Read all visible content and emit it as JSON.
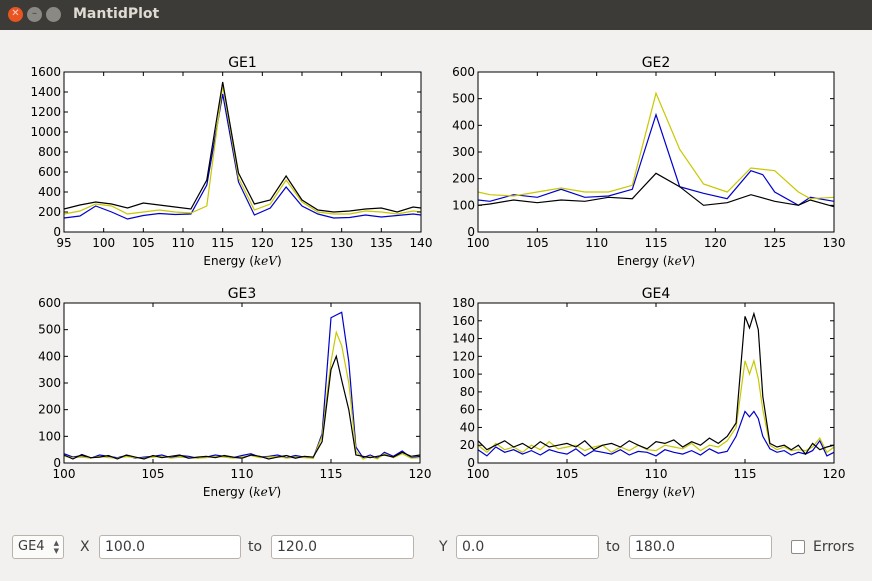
{
  "window": {
    "title": "MantidPlot"
  },
  "controls": {
    "selector_value": "GE4",
    "x_label": "X",
    "x_from": "100.0",
    "x_to_label": "to",
    "x_to": "120.0",
    "y_label": "Y",
    "y_from": "0.0",
    "y_to_label": "to",
    "y_to": "180.0",
    "errors_label": "Errors",
    "errors_checked": false
  },
  "series_colors": [
    "#0000cc",
    "#c8c800",
    "#000000"
  ],
  "chart_data": [
    {
      "type": "line",
      "title": "GE1",
      "xlabel": "Energy ",
      "xunit": "keV",
      "xlim": [
        95,
        140
      ],
      "ylim": [
        0,
        1600
      ],
      "xticks": [
        95,
        100,
        105,
        110,
        115,
        120,
        125,
        130,
        135,
        140
      ],
      "yticks": [
        0,
        200,
        400,
        600,
        800,
        1000,
        1200,
        1400,
        1600
      ],
      "series": [
        {
          "x": [
            95,
            97,
            99,
            101,
            103,
            105,
            107,
            109,
            111,
            113,
            115,
            117,
            119,
            121,
            123,
            125,
            127,
            129,
            131,
            133,
            135,
            137,
            139,
            140
          ],
          "values": [
            140,
            160,
            260,
            200,
            130,
            165,
            185,
            175,
            180,
            470,
            1380,
            500,
            170,
            240,
            450,
            260,
            180,
            140,
            145,
            170,
            150,
            165,
            180,
            170
          ]
        },
        {
          "x": [
            95,
            97,
            99,
            101,
            103,
            105,
            107,
            109,
            111,
            113,
            115,
            117,
            119,
            121,
            123,
            125,
            127,
            129,
            131,
            133,
            135,
            137,
            139,
            140
          ],
          "values": [
            180,
            210,
            280,
            260,
            180,
            200,
            220,
            200,
            190,
            260,
            1470,
            540,
            220,
            280,
            520,
            300,
            200,
            180,
            180,
            210,
            200,
            180,
            210,
            200
          ]
        },
        {
          "x": [
            95,
            97,
            99,
            101,
            103,
            105,
            107,
            109,
            111,
            113,
            115,
            117,
            119,
            121,
            123,
            125,
            127,
            129,
            131,
            133,
            135,
            137,
            139,
            140
          ],
          "values": [
            230,
            270,
            300,
            280,
            240,
            290,
            270,
            250,
            230,
            520,
            1500,
            590,
            280,
            320,
            560,
            320,
            220,
            200,
            210,
            230,
            240,
            200,
            250,
            240
          ]
        }
      ]
    },
    {
      "type": "line",
      "title": "GE2",
      "xlabel": "Energy ",
      "xunit": "keV",
      "xlim": [
        100,
        130
      ],
      "ylim": [
        0,
        600
      ],
      "xticks": [
        100,
        105,
        110,
        115,
        120,
        125,
        130
      ],
      "yticks": [
        0,
        100,
        200,
        300,
        400,
        500,
        600
      ],
      "series": [
        {
          "x": [
            100,
            101,
            103,
            105,
            107,
            109,
            111,
            113,
            115,
            117,
            119,
            121,
            123,
            124,
            125,
            127,
            128,
            130
          ],
          "values": [
            120,
            115,
            140,
            130,
            160,
            130,
            135,
            160,
            440,
            170,
            145,
            125,
            230,
            215,
            150,
            100,
            130,
            115
          ]
        },
        {
          "x": [
            100,
            101,
            103,
            105,
            107,
            109,
            111,
            113,
            115,
            117,
            119,
            121,
            123,
            125,
            127,
            128,
            130
          ],
          "values": [
            150,
            140,
            135,
            150,
            165,
            150,
            150,
            175,
            520,
            310,
            180,
            150,
            240,
            230,
            150,
            125,
            130
          ]
        },
        {
          "x": [
            100,
            101,
            103,
            105,
            107,
            109,
            111,
            113,
            115,
            117,
            119,
            121,
            123,
            125,
            127,
            128,
            130
          ],
          "values": [
            100,
            105,
            120,
            110,
            120,
            115,
            130,
            125,
            220,
            170,
            100,
            110,
            140,
            115,
            100,
            120,
            95
          ]
        }
      ]
    },
    {
      "type": "line",
      "title": "GE3",
      "xlabel": "Energy ",
      "xunit": "keV",
      "xlim": [
        100,
        120
      ],
      "ylim": [
        0,
        600
      ],
      "xticks": [
        100,
        105,
        110,
        115,
        120
      ],
      "yticks": [
        0,
        100,
        200,
        300,
        400,
        500,
        600
      ],
      "series": [
        {
          "x": [
            100,
            100.5,
            101,
            101.5,
            102,
            102.5,
            103,
            103.5,
            104,
            104.5,
            105,
            105.5,
            106,
            106.5,
            107,
            107.5,
            108,
            108.5,
            109,
            109.5,
            110,
            110.5,
            111,
            111.5,
            112,
            112.5,
            113,
            113.5,
            114,
            114.5,
            115,
            115.3,
            115.6,
            116,
            116.4,
            116.8,
            117.2,
            117.6,
            118,
            118.5,
            119,
            119.5,
            120
          ],
          "values": [
            35,
            22,
            28,
            18,
            30,
            25,
            20,
            28,
            18,
            22,
            25,
            30,
            20,
            28,
            25,
            18,
            22,
            30,
            25,
            20,
            28,
            35,
            22,
            25,
            30,
            20,
            28,
            22,
            18,
            110,
            545,
            555,
            565,
            380,
            60,
            20,
            30,
            18,
            40,
            25,
            45,
            20,
            25
          ]
        },
        {
          "x": [
            100,
            100.5,
            101,
            101.5,
            102,
            102.5,
            103,
            103.5,
            104,
            104.5,
            105,
            105.5,
            106,
            106.5,
            107,
            107.5,
            108,
            108.5,
            109,
            109.5,
            110,
            110.5,
            111,
            111.5,
            112,
            112.5,
            113,
            113.5,
            114,
            114.5,
            115,
            115.3,
            115.6,
            116,
            116.4,
            116.8,
            117.2,
            117.6,
            118,
            118.5,
            119,
            119.5,
            120
          ],
          "values": [
            25,
            20,
            22,
            18,
            25,
            20,
            18,
            24,
            20,
            18,
            22,
            25,
            18,
            22,
            20,
            18,
            20,
            25,
            22,
            18,
            22,
            28,
            20,
            22,
            25,
            18,
            22,
            20,
            18,
            100,
            380,
            490,
            440,
            300,
            45,
            15,
            25,
            15,
            35,
            20,
            35,
            18,
            20
          ]
        },
        {
          "x": [
            100,
            100.5,
            101,
            101.5,
            102,
            102.5,
            103,
            103.5,
            104,
            104.5,
            105,
            105.5,
            106,
            106.5,
            107,
            107.5,
            108,
            108.5,
            109,
            109.5,
            110,
            110.5,
            111,
            111.5,
            112,
            112.5,
            113,
            113.5,
            114,
            114.5,
            115,
            115.3,
            115.6,
            116,
            116.4,
            116.8,
            117.2,
            117.6,
            118,
            118.5,
            119,
            119.5,
            120
          ],
          "values": [
            30,
            15,
            32,
            20,
            22,
            28,
            15,
            30,
            22,
            15,
            28,
            20,
            25,
            30,
            18,
            22,
            25,
            20,
            28,
            22,
            18,
            30,
            25,
            15,
            22,
            28,
            18,
            25,
            22,
            80,
            350,
            400,
            310,
            200,
            30,
            25,
            20,
            25,
            30,
            22,
            40,
            25,
            30
          ]
        }
      ]
    },
    {
      "type": "line",
      "title": "GE4",
      "xlabel": "Energy ",
      "xunit": "keV",
      "xlim": [
        100,
        120
      ],
      "ylim": [
        0,
        180
      ],
      "xticks": [
        100,
        105,
        110,
        115,
        120
      ],
      "yticks": [
        0,
        20,
        40,
        60,
        80,
        100,
        120,
        140,
        160,
        180
      ],
      "series": [
        {
          "x": [
            100,
            100.5,
            101,
            101.5,
            102,
            102.5,
            103,
            103.5,
            104,
            104.5,
            105,
            105.5,
            106,
            106.5,
            107,
            107.5,
            108,
            108.5,
            109,
            109.5,
            110,
            110.5,
            111,
            111.5,
            112,
            112.5,
            113,
            113.5,
            114,
            114.5,
            115,
            115.25,
            115.5,
            115.75,
            116,
            116.4,
            116.8,
            117.2,
            117.6,
            118,
            118.4,
            118.8,
            119.2,
            119.6,
            120
          ],
          "values": [
            15,
            8,
            18,
            12,
            15,
            10,
            14,
            9,
            15,
            12,
            10,
            16,
            8,
            14,
            12,
            10,
            15,
            9,
            13,
            12,
            8,
            15,
            12,
            10,
            14,
            9,
            16,
            11,
            13,
            30,
            58,
            52,
            58,
            50,
            30,
            16,
            12,
            14,
            9,
            12,
            10,
            14,
            25,
            8,
            12
          ]
        },
        {
          "x": [
            100,
            100.5,
            101,
            101.5,
            102,
            102.5,
            103,
            103.5,
            104,
            104.5,
            105,
            105.5,
            106,
            106.5,
            107,
            107.5,
            108,
            108.5,
            109,
            109.5,
            110,
            110.5,
            111,
            111.5,
            112,
            112.5,
            113,
            113.5,
            114,
            114.5,
            115,
            115.25,
            115.5,
            115.75,
            116,
            116.4,
            116.8,
            117.2,
            117.6,
            118,
            118.4,
            118.8,
            119.2,
            119.6,
            120
          ],
          "values": [
            20,
            12,
            22,
            15,
            18,
            12,
            20,
            15,
            24,
            16,
            18,
            20,
            14,
            18,
            20,
            12,
            18,
            14,
            20,
            15,
            14,
            20,
            18,
            16,
            22,
            14,
            20,
            18,
            25,
            40,
            115,
            100,
            115,
            95,
            60,
            20,
            15,
            18,
            14,
            15,
            14,
            18,
            28,
            12,
            18
          ]
        },
        {
          "x": [
            100,
            100.5,
            101,
            101.5,
            102,
            102.5,
            103,
            103.5,
            104,
            104.5,
            105,
            105.5,
            106,
            106.5,
            107,
            107.5,
            108,
            108.5,
            109,
            109.5,
            110,
            110.5,
            111,
            111.5,
            112,
            112.5,
            113,
            113.5,
            114,
            114.5,
            115,
            115.25,
            115.5,
            115.75,
            116,
            116.4,
            116.8,
            117.2,
            117.6,
            118,
            118.4,
            118.8,
            119.2,
            119.6,
            120
          ],
          "values": [
            25,
            15,
            20,
            25,
            18,
            22,
            16,
            24,
            18,
            20,
            22,
            18,
            25,
            15,
            20,
            22,
            18,
            25,
            20,
            16,
            24,
            22,
            26,
            18,
            24,
            20,
            28,
            22,
            30,
            45,
            165,
            152,
            168,
            150,
            75,
            22,
            18,
            20,
            15,
            20,
            10,
            22,
            15,
            18,
            20
          ]
        }
      ]
    }
  ]
}
